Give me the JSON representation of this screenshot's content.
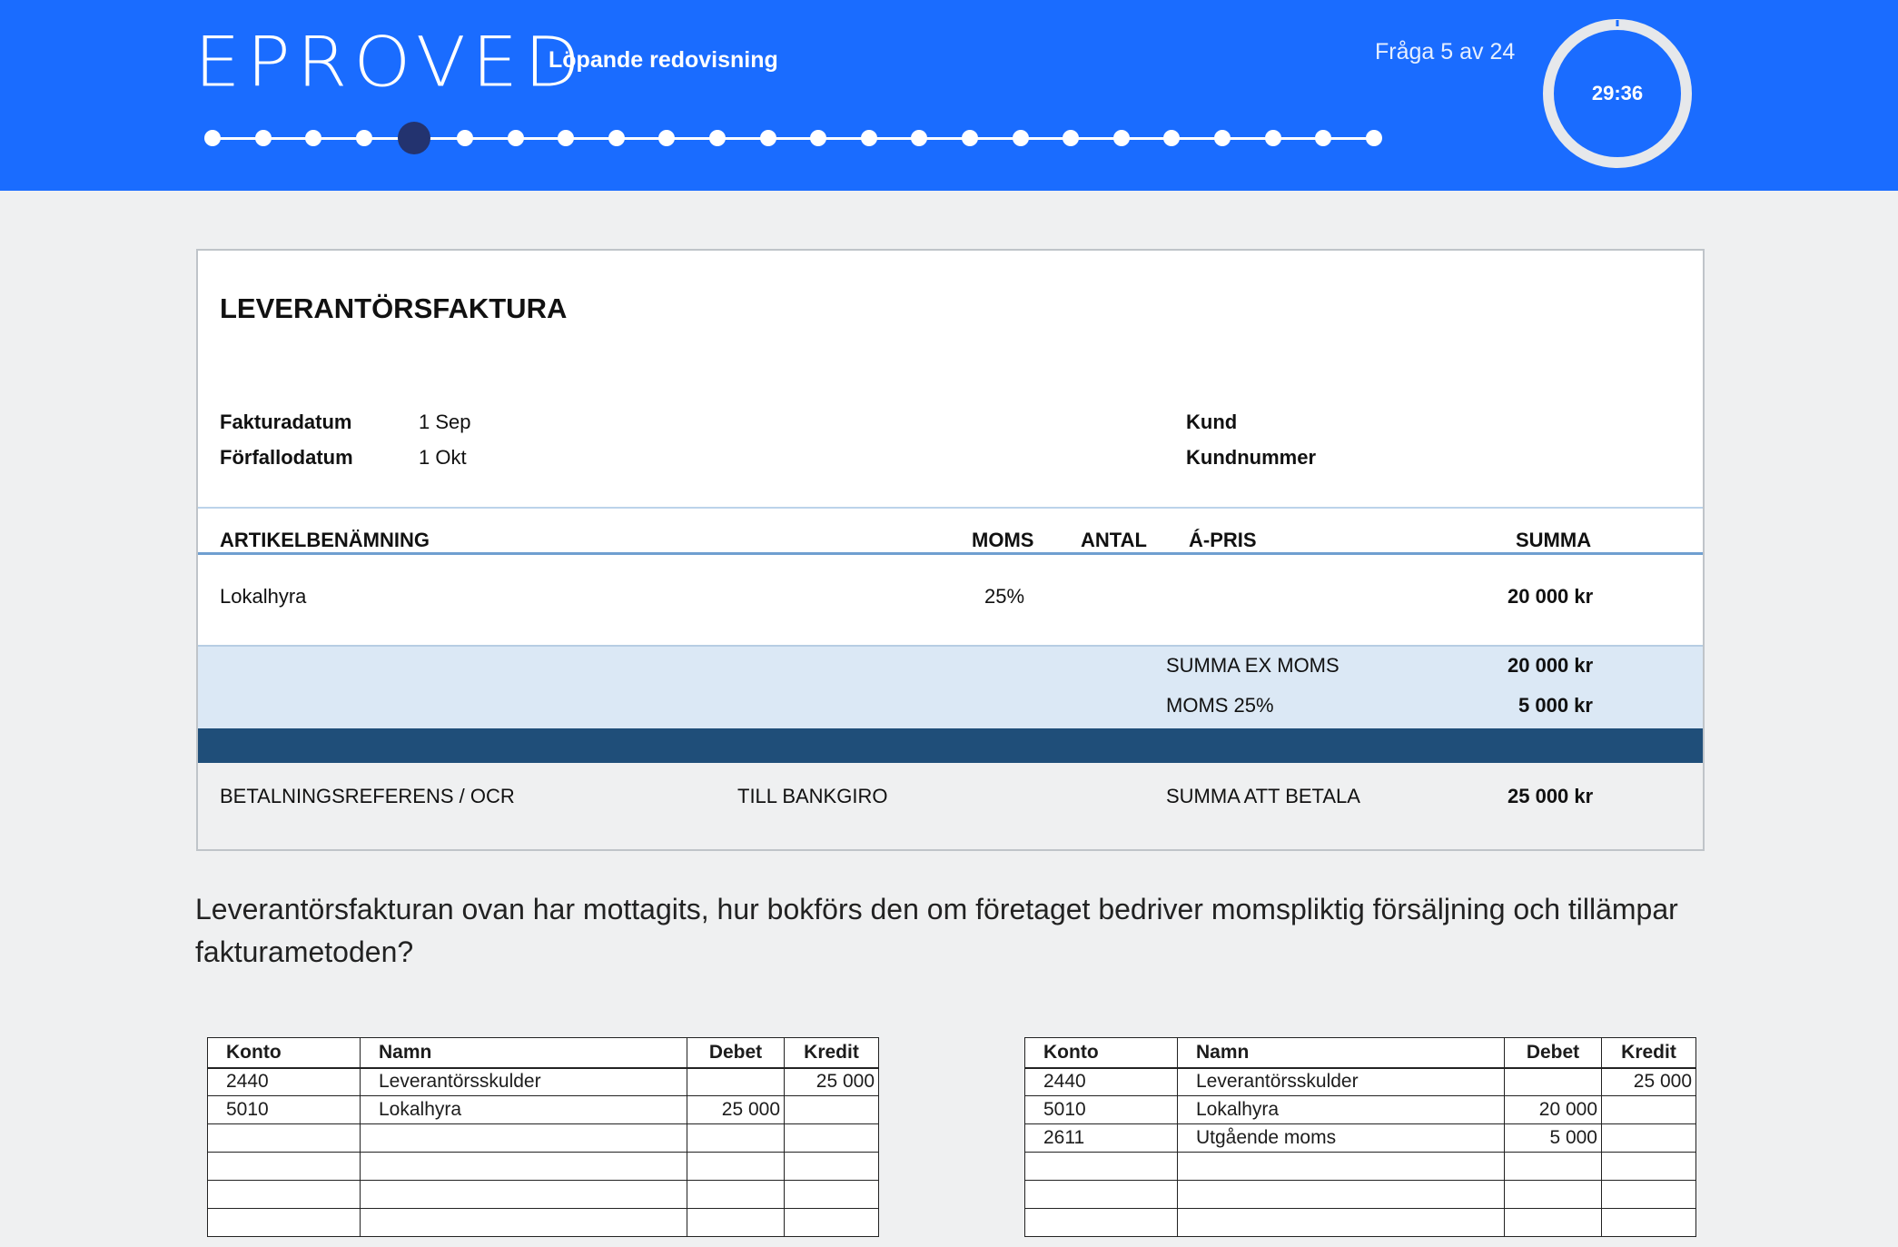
{
  "header": {
    "logo": "EPROVED",
    "subject": "Löpande redovisning",
    "question_counter": "Fråga 5 av 24",
    "timer": "29:36",
    "progress": {
      "total": 24,
      "current": 5
    }
  },
  "invoice": {
    "title": "LEVERANTÖRSFAKTURA",
    "fakturadatum_label": "Fakturadatum",
    "fakturadatum_value": "1 Sep",
    "forfallodatum_label": "Förfallodatum",
    "forfallodatum_value": "1 Okt",
    "kund_label": "Kund",
    "kundnummer_label": "Kundnummer",
    "columns": {
      "artikel": "ARTIKELBENÄMNING",
      "moms": "MOMS",
      "antal": "ANTAL",
      "apris": "Á-PRIS",
      "summa": "SUMMA"
    },
    "item": {
      "name": "Lokalhyra",
      "moms": "25%",
      "summa": "20 000 kr"
    },
    "summa_ex_moms_label": "SUMMA EX MOMS",
    "summa_ex_moms_value": "20 000 kr",
    "moms_label": "MOMS 25%",
    "moms_value": "5 000 kr",
    "betalningsreferens_label": "BETALNINGSREFERENS / OCR",
    "bankgiro_label": "TILL BANKGIRO",
    "summa_att_betala_label": "SUMMA ATT BETALA",
    "summa_att_betala_value": "25 000 kr"
  },
  "question": "Leverantörsfakturan ovan har mottagits, hur bokförs den om företaget bedriver momspliktig försäljning och tillämpar fakturametoden?",
  "answers": [
    {
      "headers": [
        "Konto",
        "Namn",
        "Debet",
        "Kredit"
      ],
      "rows": [
        [
          "2440",
          "Leverantörsskulder",
          "",
          "25 000"
        ],
        [
          "5010",
          "Lokalhyra",
          "25 000",
          ""
        ],
        [
          "",
          "",
          "",
          ""
        ],
        [
          "",
          "",
          "",
          ""
        ],
        [
          "",
          "",
          "",
          ""
        ],
        [
          "",
          "",
          "",
          ""
        ]
      ]
    },
    {
      "headers": [
        "Konto",
        "Namn",
        "Debet",
        "Kredit"
      ],
      "rows": [
        [
          "2440",
          "Leverantörsskulder",
          "",
          "25 000"
        ],
        [
          "5010",
          "Lokalhyra",
          "20 000",
          ""
        ],
        [
          "2611",
          "Utgående moms",
          "5 000",
          ""
        ],
        [
          "",
          "",
          "",
          ""
        ],
        [
          "",
          "",
          "",
          ""
        ],
        [
          "",
          "",
          "",
          ""
        ]
      ]
    }
  ],
  "colors": {
    "header_bg": "#1a6cff",
    "progress_current": "#23336f",
    "invoice_dark_band": "#1f4e79",
    "invoice_light_band": "#dbe8f5"
  }
}
